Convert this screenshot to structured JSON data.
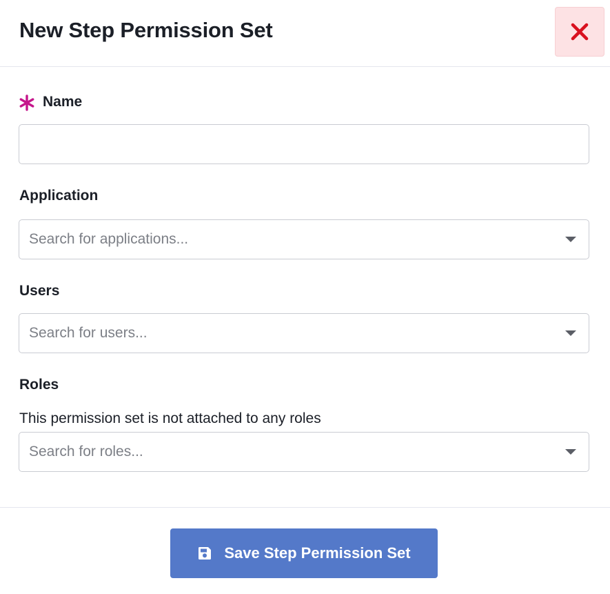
{
  "modal": {
    "title": "New Step Permission Set",
    "close_icon": "close-icon"
  },
  "form": {
    "name": {
      "label": "Name",
      "required": true,
      "required_icon": "asterisk-icon",
      "value": "",
      "placeholder": ""
    },
    "application": {
      "label": "Application",
      "placeholder": "Search for applications..."
    },
    "users": {
      "label": "Users",
      "placeholder": "Search for users..."
    },
    "roles": {
      "label": "Roles",
      "helper_text": "This permission set is not attached to any roles",
      "placeholder": "Search for roles..."
    }
  },
  "footer": {
    "save_label": "Save Step Permission Set",
    "save_icon": "floppy-disk-icon"
  },
  "colors": {
    "close_bg": "#fde2e4",
    "close_icon": "#d9111f",
    "required_star": "#c5168b",
    "primary_button": "#5479c9"
  }
}
